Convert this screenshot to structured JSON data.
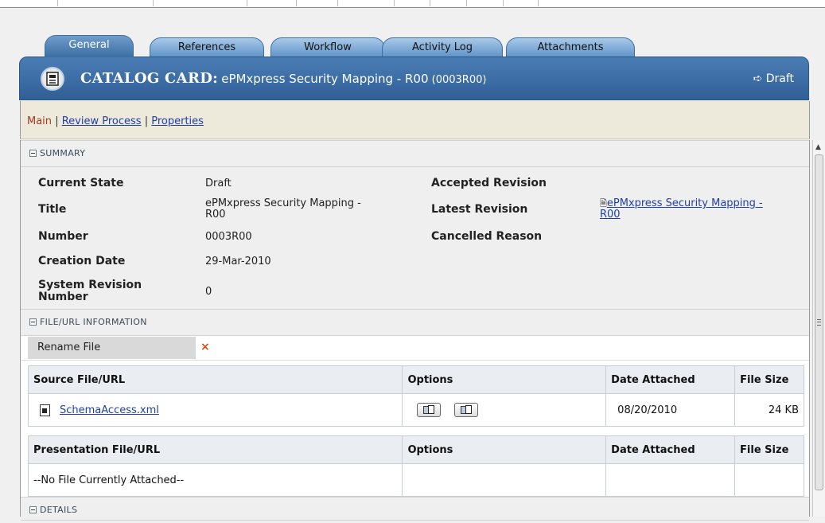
{
  "tabs": [
    "General",
    "References",
    "Workflow",
    "Activity Log",
    "Attachments"
  ],
  "header": {
    "label": "CATALOG CARD:",
    "name": "ePMxpress Security Mapping - R00",
    "code": "(0003R00)",
    "state": "Draft",
    "state_icon": "arrow-right-icon"
  },
  "subnav": {
    "current": "Main",
    "separator": "|",
    "links": [
      "Review Process",
      "Properties"
    ]
  },
  "summary": {
    "heading": "SUMMARY",
    "current_state_label": "Current State",
    "current_state": "Draft",
    "title_label": "Title",
    "title_line1": "ePMxpress Security Mapping -",
    "title_line2": "R00",
    "number_label": "Number",
    "number": "0003R00",
    "creation_date_label": "Creation Date",
    "creation_date": "29-Mar-2010",
    "sys_rev_label_1": "System Revision",
    "sys_rev_label_2": "Number",
    "sys_rev": "0",
    "accepted_revision_label": "Accepted Revision",
    "latest_revision_label": "Latest Revision",
    "latest_revision_line1": "ePMxpress Security Mapping -",
    "latest_revision_line2": "R00",
    "cancelled_reason_label": "Cancelled Reason"
  },
  "file_info": {
    "heading": "FILE/URL INFORMATION",
    "rename_label": "Rename File",
    "rename_mark": "×",
    "source_table": {
      "headers": [
        "Source File/URL",
        "Options",
        "Date Attached",
        "File Size"
      ],
      "file_name": "SchemaAccess.xml",
      "date_attached": "08/20/2010",
      "file_size": "24 KB"
    },
    "presentation_table": {
      "headers": [
        "Presentation File/URL",
        "Options",
        "Date Attached",
        "File Size"
      ],
      "empty_text": "--No File Currently Attached--"
    }
  },
  "details": {
    "heading": "DETAILS"
  },
  "colors": {
    "header_blue": "#3a6ca3",
    "tab_blue": "#6a9fd3",
    "subnav_bg": "#edeadc",
    "current_link": "#a23a1e",
    "link": "#1f3fa6",
    "delete_x": "#d54b1a"
  }
}
